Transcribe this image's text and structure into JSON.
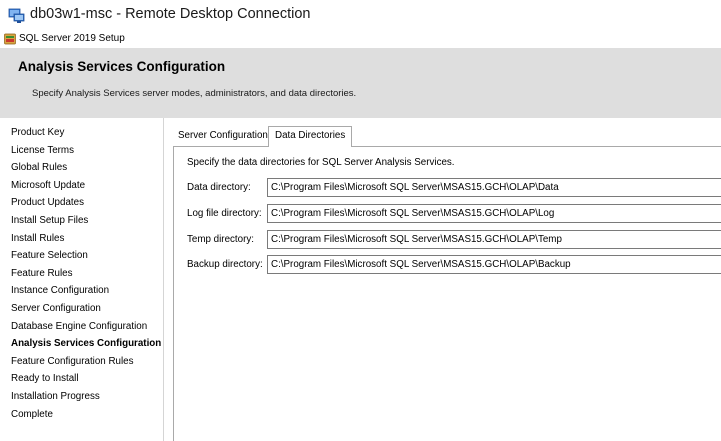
{
  "rdp": {
    "title": "db03w1-msc - Remote Desktop Connection",
    "icon": "remote-desktop-icon"
  },
  "setup": {
    "title": "SQL Server 2019 Setup",
    "icon": "sql-setup-icon"
  },
  "header": {
    "title": "Analysis Services Configuration",
    "subtitle": "Specify Analysis Services server modes, administrators, and data directories."
  },
  "nav": {
    "items": [
      {
        "label": "Product Key",
        "active": false
      },
      {
        "label": "License Terms",
        "active": false
      },
      {
        "label": "Global Rules",
        "active": false
      },
      {
        "label": "Microsoft Update",
        "active": false
      },
      {
        "label": "Product Updates",
        "active": false
      },
      {
        "label": "Install Setup Files",
        "active": false
      },
      {
        "label": "Install Rules",
        "active": false
      },
      {
        "label": "Feature Selection",
        "active": false
      },
      {
        "label": "Feature Rules",
        "active": false
      },
      {
        "label": "Instance Configuration",
        "active": false
      },
      {
        "label": "Server Configuration",
        "active": false
      },
      {
        "label": "Database Engine Configuration",
        "active": false
      },
      {
        "label": "Analysis Services Configuration",
        "active": true
      },
      {
        "label": "Feature Configuration Rules",
        "active": false
      },
      {
        "label": "Ready to Install",
        "active": false
      },
      {
        "label": "Installation Progress",
        "active": false
      },
      {
        "label": "Complete",
        "active": false
      }
    ]
  },
  "tabs": {
    "server_configuration": "Server Configuration",
    "data_directories": "Data Directories",
    "selected": "Data Directories"
  },
  "panel": {
    "description": "Specify the data directories for SQL Server Analysis Services.",
    "fields": {
      "data": {
        "label": "Data directory:",
        "value": "C:\\Program Files\\Microsoft SQL Server\\MSAS15.GCH\\OLAP\\Data"
      },
      "log": {
        "label": "Log file directory:",
        "value": "C:\\Program Files\\Microsoft SQL Server\\MSAS15.GCH\\OLAP\\Log"
      },
      "temp": {
        "label": "Temp directory:",
        "value": "C:\\Program Files\\Microsoft SQL Server\\MSAS15.GCH\\OLAP\\Temp"
      },
      "backup": {
        "label": "Backup directory:",
        "value": "C:\\Program Files\\Microsoft SQL Server\\MSAS15.GCH\\OLAP\\Backup"
      }
    }
  },
  "colors": {
    "header_band": "#dedede",
    "border": "#a9a9a9"
  }
}
